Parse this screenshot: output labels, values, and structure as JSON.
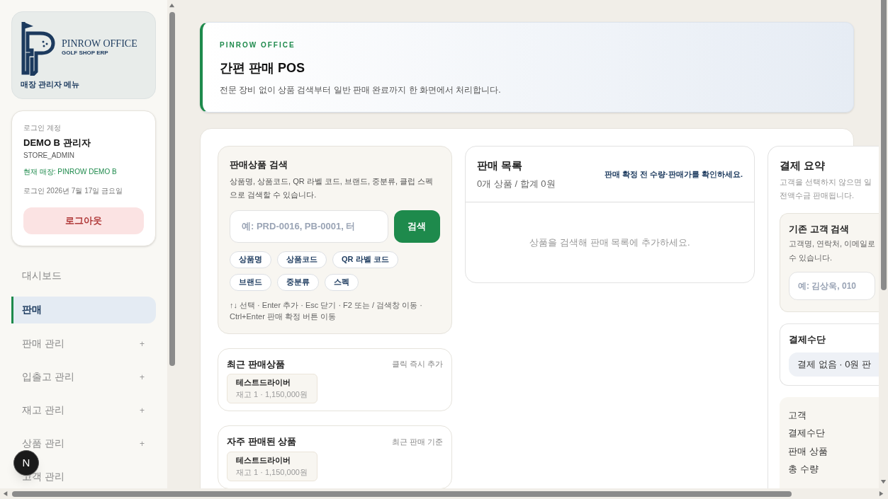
{
  "sidebar": {
    "brand": {
      "name": "PINROW OFFICE",
      "tagline": "GOLF SHOP ERP",
      "caption": "매장 관리자 메뉴"
    },
    "account": {
      "label": "로그인 계정",
      "name": "DEMO B 관리자",
      "role": "STORE_ADMIN",
      "store": "현재 매장: PINROW DEMO B",
      "login_date": "로그인 2026년 7월 17일 금요일",
      "logout": "로그아웃"
    },
    "items": [
      {
        "label": "대시보드",
        "selected": false
      },
      {
        "label": "판매",
        "selected": true
      },
      {
        "label": "판매 관리",
        "selected": false,
        "toggle": "+"
      },
      {
        "label": "입출고 관리",
        "selected": false,
        "toggle": "+"
      },
      {
        "label": "재고 관리",
        "selected": false,
        "toggle": "+"
      },
      {
        "label": "상품 관리",
        "selected": false,
        "toggle": "+"
      },
      {
        "label": "고객 관리",
        "selected": false
      }
    ]
  },
  "dev_badge": {
    "label": "N"
  },
  "header": {
    "eyebrow": "PINROW OFFICE",
    "title": "간편 판매 POS",
    "description": "전문 장비 없이 상품 검색부터 일반 판매 완료까지 한 화면에서 처리합니다."
  },
  "product_search": {
    "title": "판매상품 검색",
    "description": "상품명, 상품코드, QR 라벨 코드, 브랜드, 중분류, 클럽 스펙으로 검색할 수 있습니다.",
    "placeholder": "예: PRD-0016, PB-0001, 터",
    "button": "검색",
    "chips": [
      "상품명",
      "상품코드",
      "QR 라벨 코드",
      "브랜드",
      "중분류",
      "스펙"
    ],
    "shortcuts": "↑↓ 선택 · Enter 추가 · Esc 닫기 · F2 또는 / 검색창 이동 · Ctrl+Enter 판매 확정 버튼 이동"
  },
  "quick_lists": [
    {
      "title": "최근 판매상품",
      "hint": "클릭 즉시 추가",
      "products": [
        {
          "name": "테스트드라이버",
          "detail": "재고 1 · 1,150,000원"
        }
      ]
    },
    {
      "title": "자주 판매된 상품",
      "hint": "최근 판매 기준",
      "products": [
        {
          "name": "테스트드라이버",
          "detail": "재고 1 · 1,150,000원"
        }
      ]
    }
  ],
  "sale_list": {
    "title": "판매 목록",
    "summary": "0개 상품 / 합계 0원",
    "notice": "판매 확정 전 수량·판매가를 확인하세요.",
    "empty": "상품을 검색해 판매 목록에 추가하세요."
  },
  "payment_summary": {
    "title": "결제 요약",
    "description": [
      "고객을 선택하지 않으면 일",
      "전액수금 판매됩니다."
    ],
    "customer_search": {
      "title": "기존 고객 검색",
      "description": [
        "고객명, 연락처, 이메일로",
        "수 있습니다."
      ],
      "placeholder": "예: 김상욱, 010"
    },
    "payment_method": {
      "title": "결제수단",
      "value": "결제 없음 · 0원 판"
    },
    "rows": [
      "고객",
      "결제수단",
      "판매 상품",
      "총 수량"
    ]
  }
}
